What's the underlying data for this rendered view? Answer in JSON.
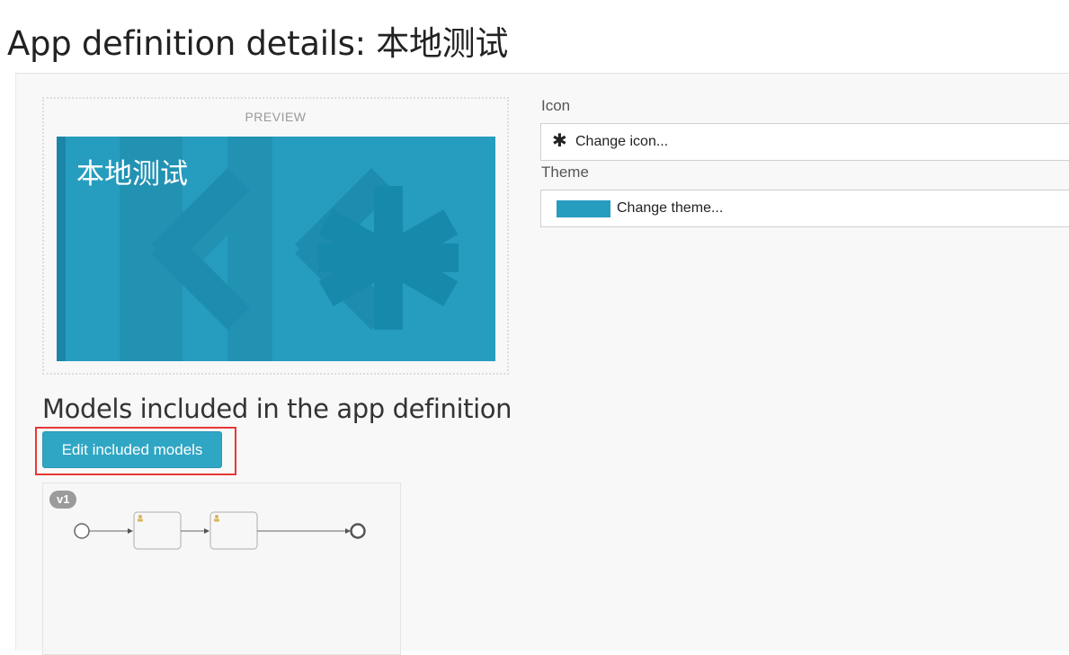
{
  "page": {
    "title": "App definition details: 本地测试"
  },
  "preview": {
    "label": "PREVIEW",
    "tile_title": "本地测试",
    "tile_color": "#269dbf",
    "tile_icon": "asterisk-icon"
  },
  "icon_field": {
    "label": "Icon",
    "glyph": "✱",
    "button_label": "Change icon..."
  },
  "theme_field": {
    "label": "Theme",
    "swatch_color": "#269dbf",
    "button_label": "Change theme..."
  },
  "models_section": {
    "title": "Models included in the app definition",
    "edit_button_label": "Edit included models",
    "highlight_color": "#e53935"
  },
  "model_thumbnail": {
    "version": "v1",
    "diagram": {
      "nodes": [
        "start-event",
        "user-task",
        "user-task",
        "end-event"
      ]
    }
  }
}
